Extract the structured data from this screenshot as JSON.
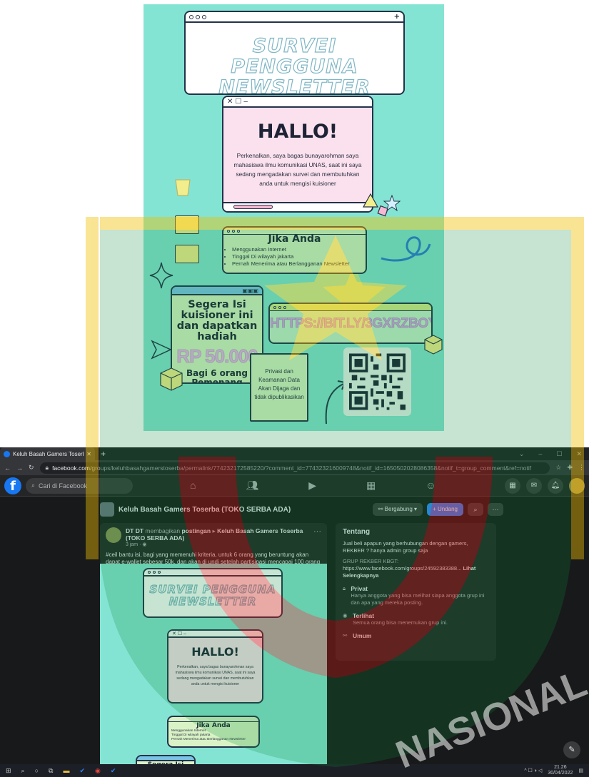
{
  "poster": {
    "survey_title": "SURVEI PENGGUNA NEWSLETTER",
    "hallo_title": "HALLO!",
    "hallo_body": "Perkenalkan, saya bagas bunayarohman saya mahasiswa ilmu komunikasi UNAS, saat ini saya sedang mengadakan survei dan membutuhkan anda untuk mengisi kuisioner",
    "jika_title": "Jika Anda",
    "jika_items": [
      "Menggunakan Internet",
      "Tinggal Di wilayah jakarta",
      "Pernah Menerima atau Berlangganan Newsletter"
    ],
    "segera_title": "Segera Isi kuisioner ini dan dapatkan hadiah",
    "reward_amount": "RP 50.000",
    "winners": "Bagi 6 orang Pemenang",
    "form_link": "HTTPS://BIT.LY/3GXRZBOY",
    "privacy_note": "Privasi dan Keamanan Data Akan Dijaga dan tidak dipublikasikan",
    "colors": {
      "background": "#84e4d3",
      "pink": "#fbe1ee",
      "green": "#d9f3c6"
    }
  },
  "browser": {
    "tab_title": "Keluh Basah Gamers Toserba (TO",
    "address_domain": "facebook.com",
    "address_path": "/groups/keluhbasahgamerstoserba/permalink/774232172585220/?comment_id=774323216009748&notif_id=1650502028086358&notif_t=group_comment&ref=notif",
    "search_placeholder": "Cari di Facebook",
    "group_name": "Keluh Basah Gamers Toserba (TOKO SERBA ADA)",
    "join_label": "Bergabung",
    "invite_label": "+ Undang",
    "post": {
      "author": "DT DT",
      "action": "membagikan",
      "action_object": "postingan",
      "target": "Keluh Basah Gamers Toserba (TOKO SERBA ADA)",
      "time": "3 jam",
      "text": "#ceil bantu isi, bagi yang memenuhi kriteria, untuk 6 orang yang beruntung akan dapat e-wallet sebesar 50k, dan akan di undi setelah partisipasi mencapai 100 orang"
    },
    "about": {
      "title": "Tentang",
      "description": "Jual beli apapun yang berhubungan dengan gamers, REKBER ? hanya admin group saja",
      "group_rekber": "GRUP REKBER KBGT:",
      "link": "https://www.facebook.com/groups/24592383388...",
      "see_more": "Lihat Selengkapnya",
      "private_title": "Privat",
      "private_desc": "Hanya anggota yang bisa melihat siapa anggota grup ini dan apa yang mereka posting.",
      "visible_title": "Terlihat",
      "visible_desc": "Semua orang bisa menemukan grup ini.",
      "general_title": "Umum"
    },
    "tray_time": "21.26",
    "tray_date": "30/04/2022"
  },
  "watermark": {
    "text": "NASIONAL"
  }
}
